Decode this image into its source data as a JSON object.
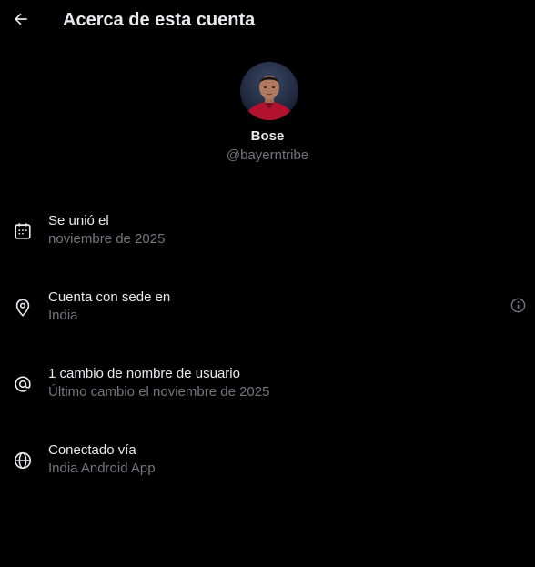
{
  "header": {
    "title": "Acerca de esta cuenta",
    "back_icon": "arrow-left-icon"
  },
  "profile": {
    "name": "Bose",
    "handle": "@bayerntribe"
  },
  "rows": [
    {
      "icon": "calendar-icon",
      "primary": "Se unió el",
      "secondary": "noviembre de 2025"
    },
    {
      "icon": "location-pin-icon",
      "primary": "Cuenta con sede en",
      "secondary": "India",
      "trailing_icon": "info-icon"
    },
    {
      "icon": "at-sign-icon",
      "primary": "1 cambio de nombre de usuario",
      "secondary": "Último cambio el noviembre de 2025"
    },
    {
      "icon": "globe-icon",
      "primary": "Conectado vía",
      "secondary": "India Android App"
    }
  ],
  "colors": {
    "background": "#000000",
    "primary_text": "#e7e9ea",
    "secondary_text": "#71767b"
  }
}
